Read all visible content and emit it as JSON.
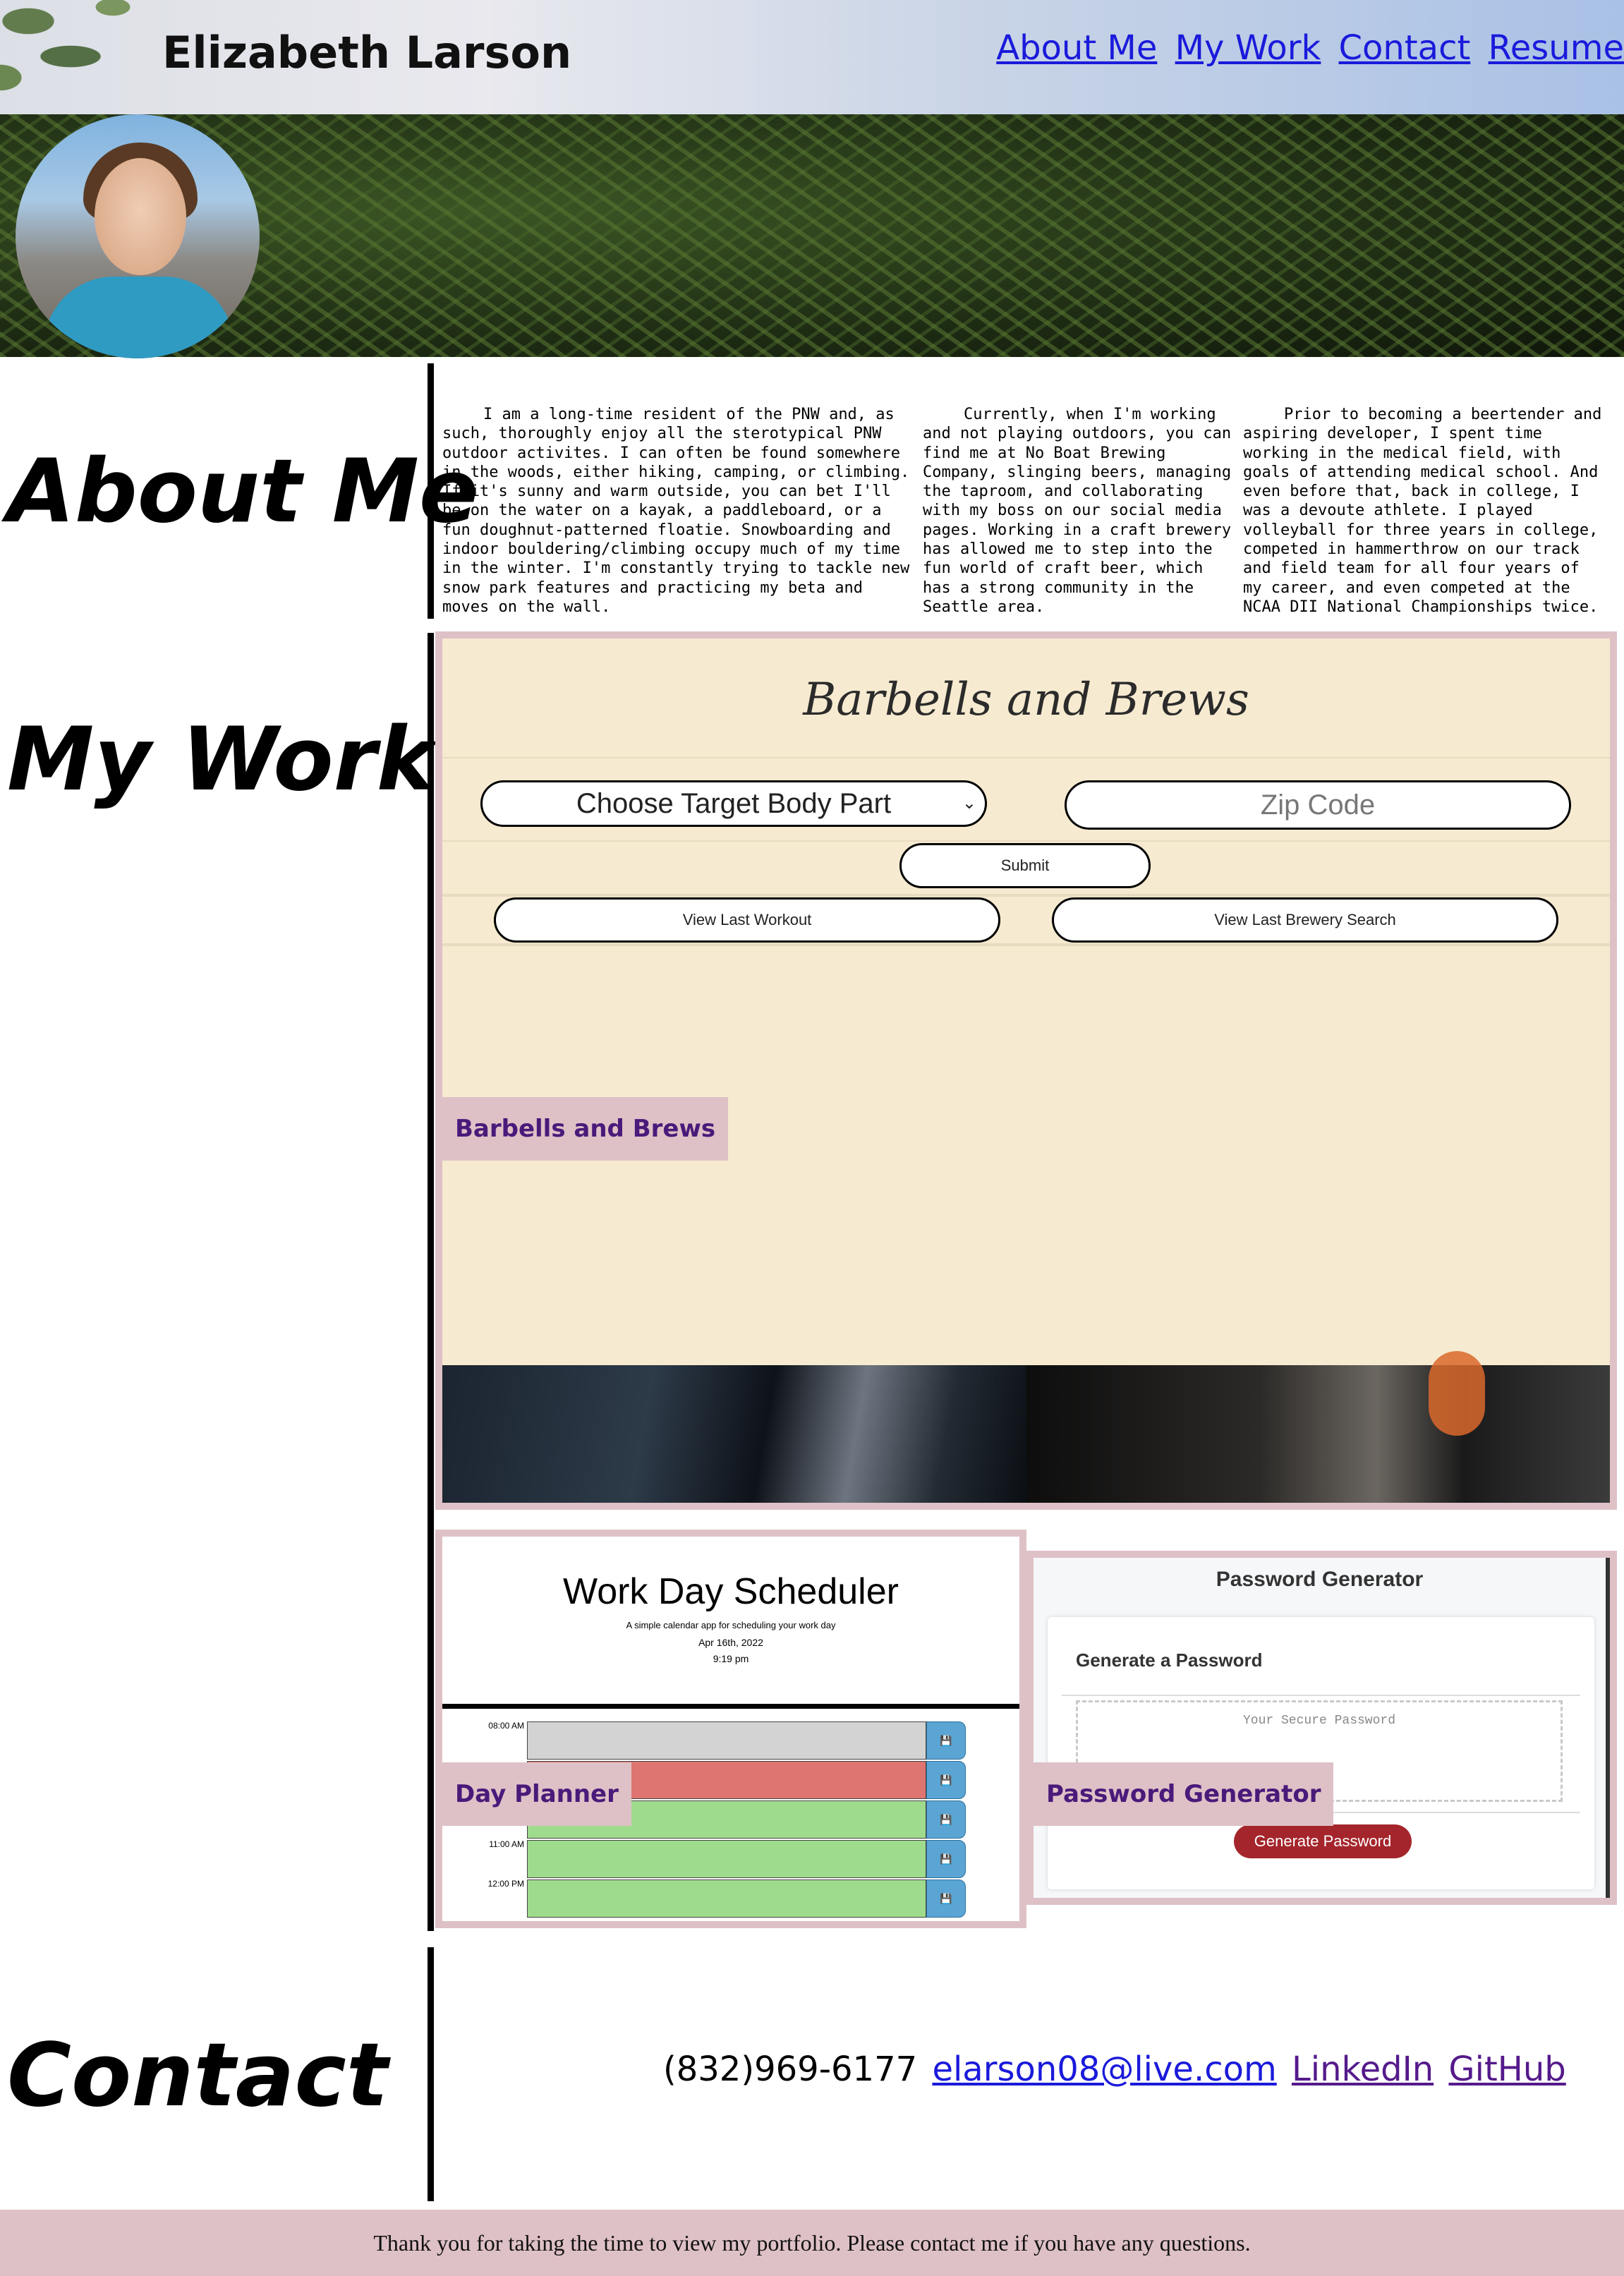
{
  "header": {
    "site_title": "Elizabeth Larson",
    "nav": [
      "About Me",
      "My Work",
      "Contact",
      "Resume"
    ]
  },
  "about": {
    "heading": "About Me",
    "paragraphs": [
      "I am a long-time resident of the PNW and, as such, thoroughly enjoy all the sterotypical PNW outdoor activites. I can often be found somewhere in the woods, either hiking, camping, or climbing. If it's sunny and warm outside, you can bet I'll be on the water on a kayak, a paddleboard, or a fun doughnut-patterned floatie. Snowboarding and indoor bouldering/climbing occupy much of my time in the winter. I'm constantly trying to tackle new snow park features and practicing my beta and moves on the wall.",
      "Currently, when I'm working and not playing outdoors, you can find me at No Boat Brewing Company, slinging beers, managing the taproom, and collaborating with my boss on our social media pages. Working in a craft brewery has allowed me to step into the fun world of craft beer, which has a strong community in the Seattle area.",
      "Prior to becoming a beertender and aspiring developer, I spent time working in the medical field, with goals of attending medical school. And even before that, back in college, I was a devoute athlete. I played volleyball for three years in college, competed in hammerthrow on our track and field team for all four years of my career, and even competed at the NCAA DII National Championships twice."
    ]
  },
  "work": {
    "heading": "My Work",
    "barbells": {
      "app_title": "Barbells and Brews",
      "select_value": "Choose Target Body Part",
      "zip_placeholder": "Zip Code",
      "submit": "Submit",
      "view_workout": "View Last Workout",
      "view_brewery": "View Last Brewery Search",
      "label": "Barbells and Brews"
    },
    "planner": {
      "title": "Work Day Scheduler",
      "subtitle": "A simple calendar app for scheduling your work day",
      "date": "Apr 16th, 2022",
      "time": "9:19 pm",
      "hours": [
        "08:00 AM",
        "",
        "AM",
        "11:00 AM",
        "12:00 PM"
      ],
      "colors": [
        "#d3d3d3",
        "#df7570",
        "#9fdb8c",
        "#9fdb8c",
        "#9fdb8c"
      ],
      "label": "Day Planner"
    },
    "password": {
      "title": "Password Generator",
      "card_heading": "Generate a Password",
      "placeholder": "Your Secure Password",
      "button": "Generate Password",
      "label": "Password Generator"
    }
  },
  "contact": {
    "heading": "Contact",
    "phone": "(832)969-6177",
    "email": "elarson08@live.com",
    "linkedin": "LinkedIn",
    "github": "GitHub"
  },
  "footer": {
    "text": "Thank you for taking the time to view my portfolio. Please contact me if you have any questions."
  }
}
